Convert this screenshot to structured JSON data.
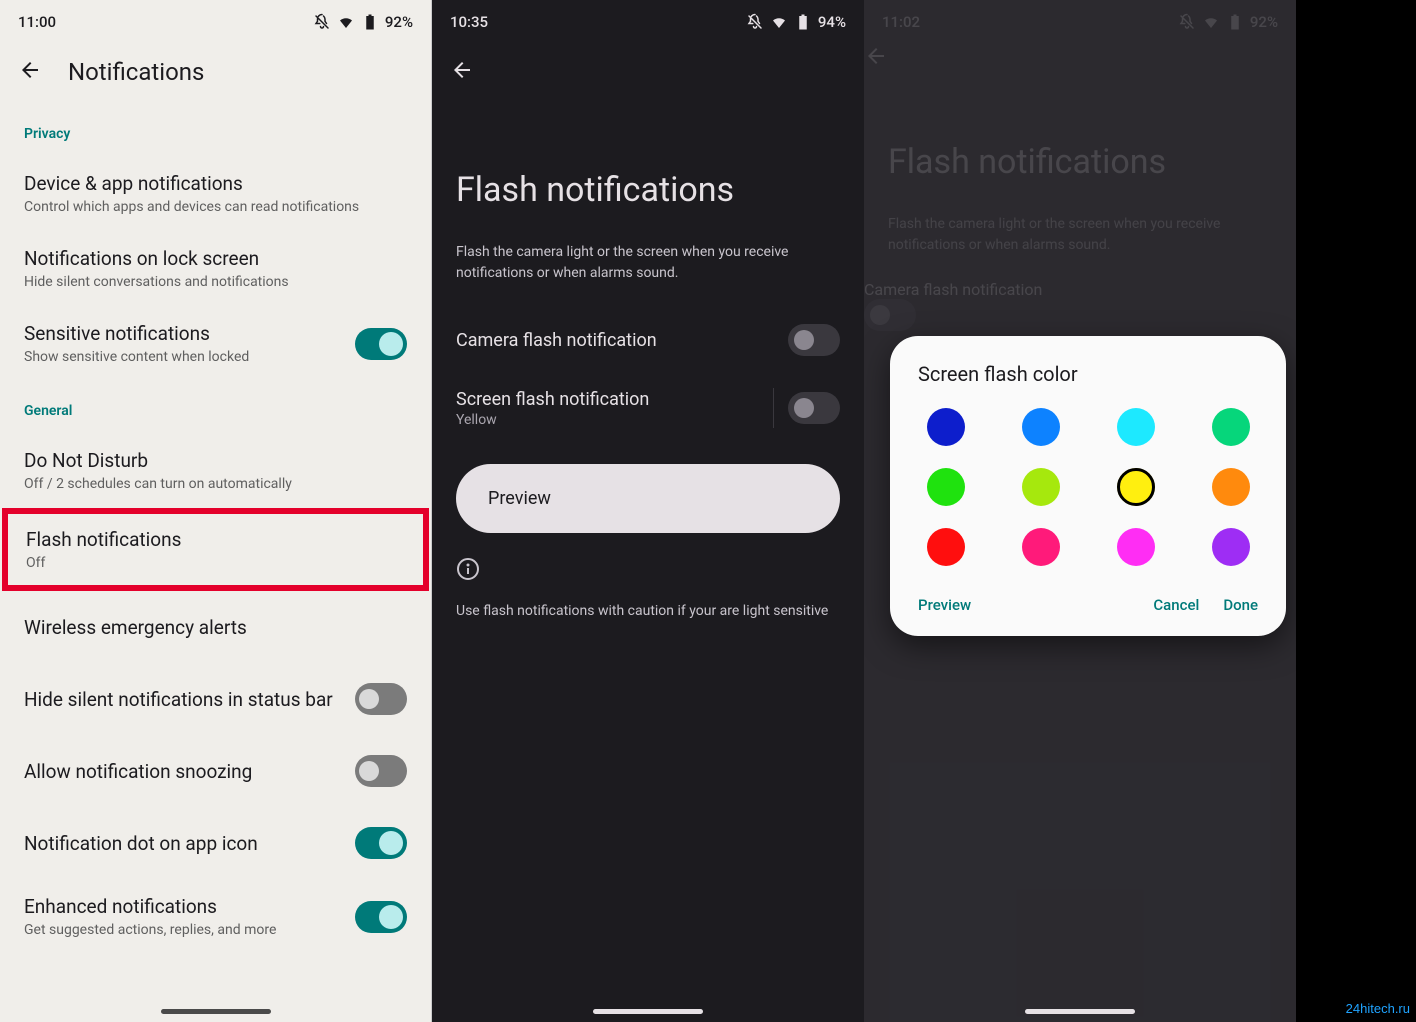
{
  "watermark": "24hitech.ru",
  "p1": {
    "status": {
      "time": "11:00",
      "battery": "92%"
    },
    "title": "Notifications",
    "sections": {
      "privacy_header": "Privacy",
      "general_header": "General"
    },
    "items": {
      "device_apps": {
        "title": "Device & app notifications",
        "sub": "Control which apps and devices can read notifications"
      },
      "lock_screen": {
        "title": "Notifications on lock screen",
        "sub": "Hide silent conversations and notifications"
      },
      "sensitive": {
        "title": "Sensitive notifications",
        "sub": "Show sensitive content when locked"
      },
      "dnd": {
        "title": "Do Not Disturb",
        "sub": "Off / 2 schedules can turn on automatically"
      },
      "flash": {
        "title": "Flash notifications",
        "sub": "Off"
      },
      "wireless": {
        "title": "Wireless emergency alerts"
      },
      "hide_silent": {
        "title": "Hide silent notifications in status bar"
      },
      "snooze": {
        "title": "Allow notification snoozing"
      },
      "dot": {
        "title": "Notification dot on app icon"
      },
      "enhanced": {
        "title": "Enhanced notifications",
        "sub": "Get suggested actions, replies, and more"
      }
    }
  },
  "p2": {
    "status": {
      "time": "10:35",
      "battery": "94%"
    },
    "title": "Flash notifications",
    "desc": "Flash the camera light or the screen when you receive notifications or when alarms sound.",
    "rows": {
      "camera": {
        "title": "Camera flash notification"
      },
      "screen": {
        "title": "Screen flash notification",
        "sub": "Yellow"
      }
    },
    "preview": "Preview",
    "caution": "Use flash notifications with caution if your are light sensitive"
  },
  "p3": {
    "status": {
      "time": "11:02",
      "battery": "92%"
    },
    "title": "Flash notifications",
    "desc": "Flash the camera light or the screen when you receive notifications or when alarms sound.",
    "rows": {
      "camera_partial": "Camera flash notification"
    },
    "dialog": {
      "title": "Screen flash color",
      "colors": [
        {
          "hex": "#0d1ecc",
          "selected": false
        },
        {
          "hex": "#0d82ff",
          "selected": false
        },
        {
          "hex": "#1de9ff",
          "selected": false
        },
        {
          "hex": "#06d67b",
          "selected": false
        },
        {
          "hex": "#1fe20e",
          "selected": false
        },
        {
          "hex": "#a6e80d",
          "selected": false
        },
        {
          "hex": "#ffef0f",
          "selected": true
        },
        {
          "hex": "#ff8a0d",
          "selected": false
        },
        {
          "hex": "#ff0e0e",
          "selected": false
        },
        {
          "hex": "#ff1a7a",
          "selected": false
        },
        {
          "hex": "#ff2df4",
          "selected": false
        },
        {
          "hex": "#9e2df4",
          "selected": false
        }
      ],
      "actions": {
        "preview": "Preview",
        "cancel": "Cancel",
        "done": "Done"
      }
    }
  }
}
